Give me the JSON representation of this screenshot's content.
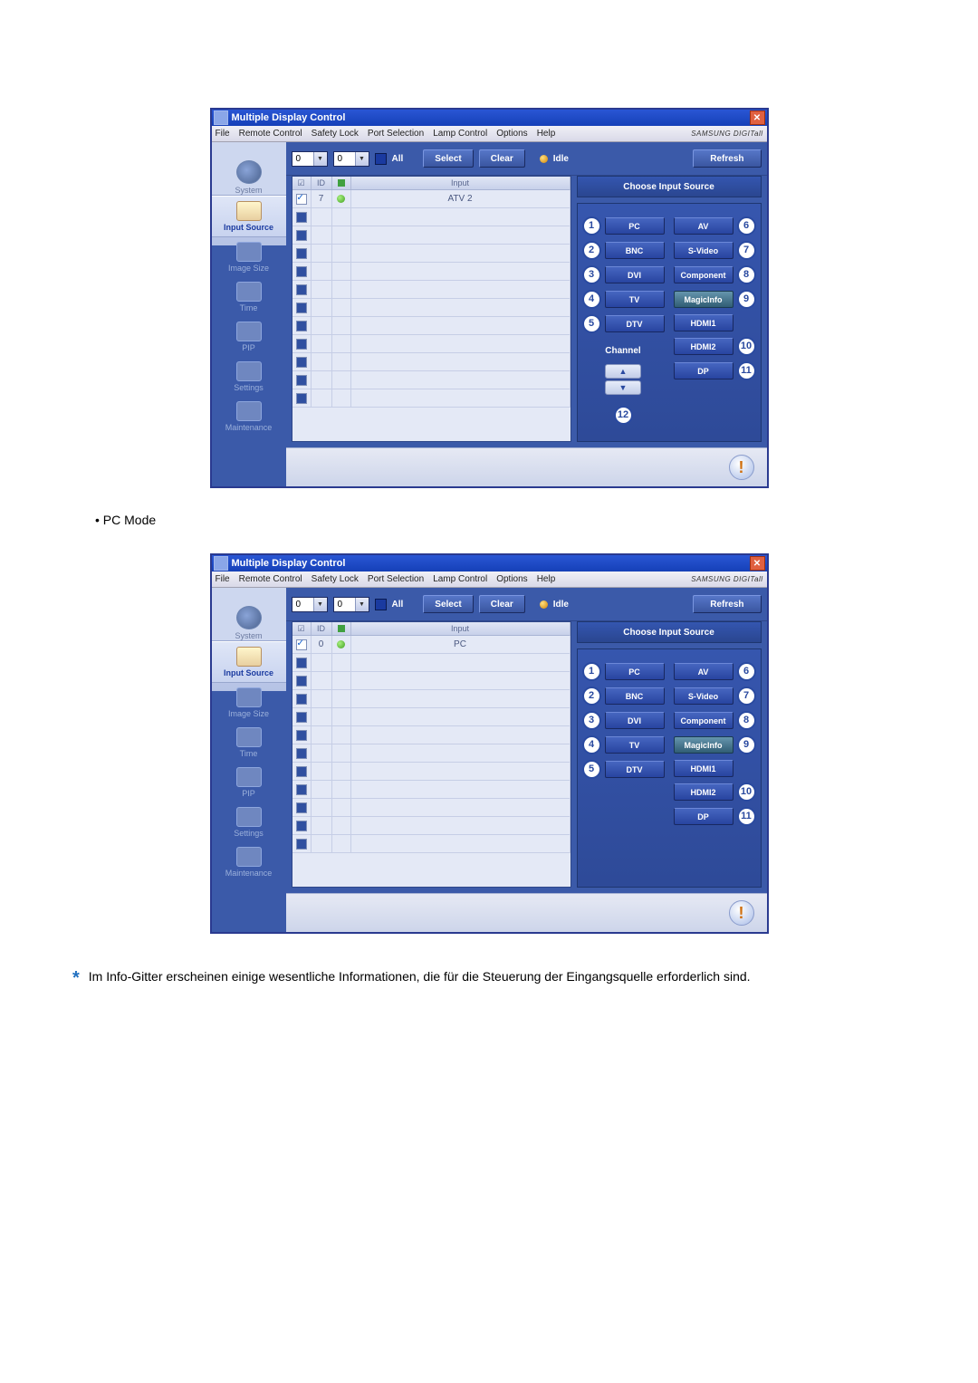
{
  "captions": {
    "pc_mode": "• PC Mode"
  },
  "note": {
    "star": "*",
    "text": "Im Info-Gitter erscheinen einige wesentliche Informationen, die für die Steuerung der Eingangsquelle erforderlich sind."
  },
  "app": {
    "title": "Multiple Display Control",
    "brand": "SAMSUNG DIGITall"
  },
  "menu": {
    "file": "File",
    "remote_control": "Remote Control",
    "safety_lock": "Safety Lock",
    "port_selection": "Port Selection",
    "lamp_control": "Lamp Control",
    "options": "Options",
    "help": "Help"
  },
  "toolbar": {
    "dd1": "0",
    "dd2": "0",
    "all": "All",
    "select": "Select",
    "clear": "Clear",
    "idle": "Idle",
    "refresh": "Refresh"
  },
  "sidebar": {
    "system": "System",
    "input_source": "Input Source",
    "image_size": "Image Size",
    "time": "Time",
    "pip": "PIP",
    "settings": "Settings",
    "maintenance": "Maintenance"
  },
  "grid": {
    "head_chk": "☑",
    "head_id": "ID",
    "head_status": "●",
    "head_input": "Input",
    "row1_id_a": "7",
    "row1_input_a": "ATV 2",
    "row1_id_b": "0",
    "row1_input_b": "PC"
  },
  "panel": {
    "header": "Choose Input Source",
    "pc": "PC",
    "bnc": "BNC",
    "dvi": "DVI",
    "tv": "TV",
    "dtv": "DTV",
    "av": "AV",
    "svideo": "S-Video",
    "component": "Component",
    "magicinfo": "MagicInfo",
    "hdmi1": "HDMI1",
    "hdmi2": "HDMI2",
    "dp": "DP",
    "channel": "Channel",
    "n1": "1",
    "n2": "2",
    "n3": "3",
    "n4": "4",
    "n5": "5",
    "n6": "6",
    "n7": "7",
    "n8": "8",
    "n9": "9",
    "n10": "10",
    "n11": "11",
    "n12": "12"
  }
}
